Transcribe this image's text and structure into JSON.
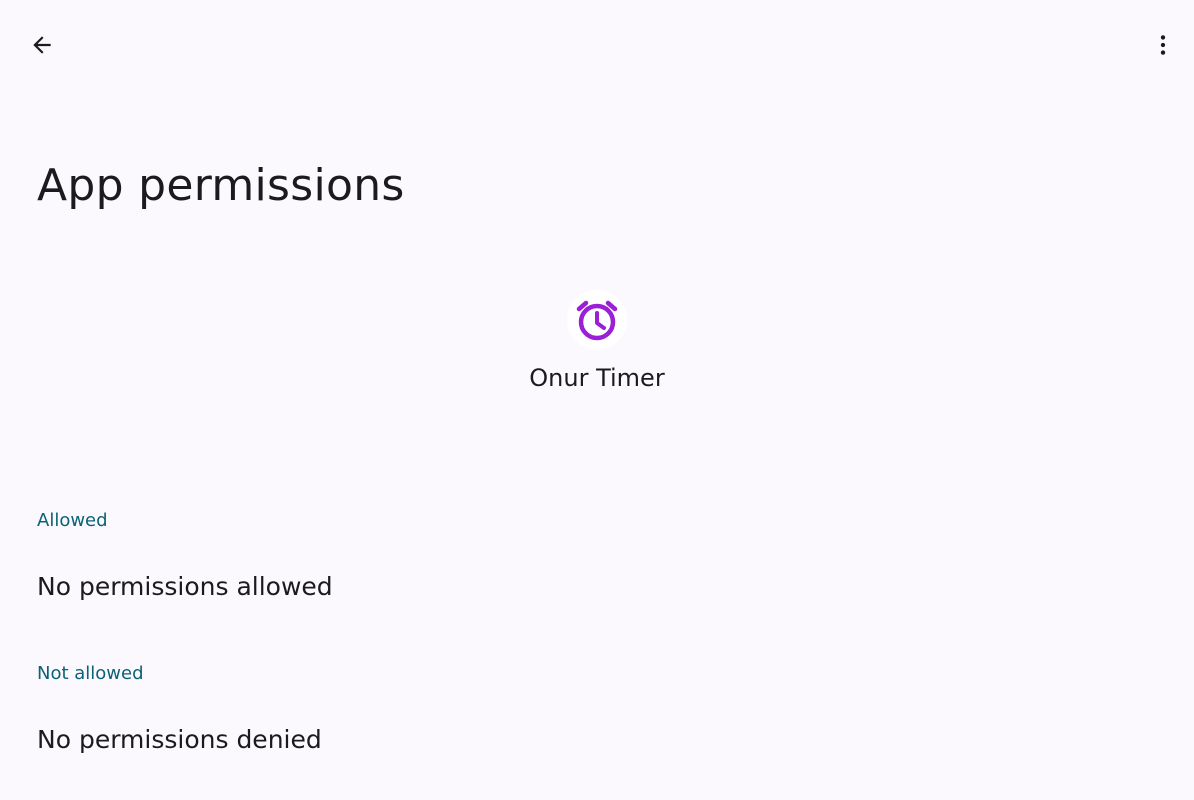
{
  "toolbar": {
    "back_icon": "arrow-back-icon",
    "more_icon": "more-vert-icon"
  },
  "page": {
    "title": "App permissions"
  },
  "app": {
    "name": "Onur Timer",
    "icon": "alarm-clock-icon",
    "icon_color": "#9a1fd6"
  },
  "sections": {
    "allowed": {
      "header": "Allowed",
      "empty_text": "No permissions allowed"
    },
    "not_allowed": {
      "header": "Not allowed",
      "empty_text": "No permissions denied"
    }
  },
  "colors": {
    "background": "#fbf9fd",
    "section_header": "#0b6277",
    "text_primary": "#1b1b1f"
  }
}
